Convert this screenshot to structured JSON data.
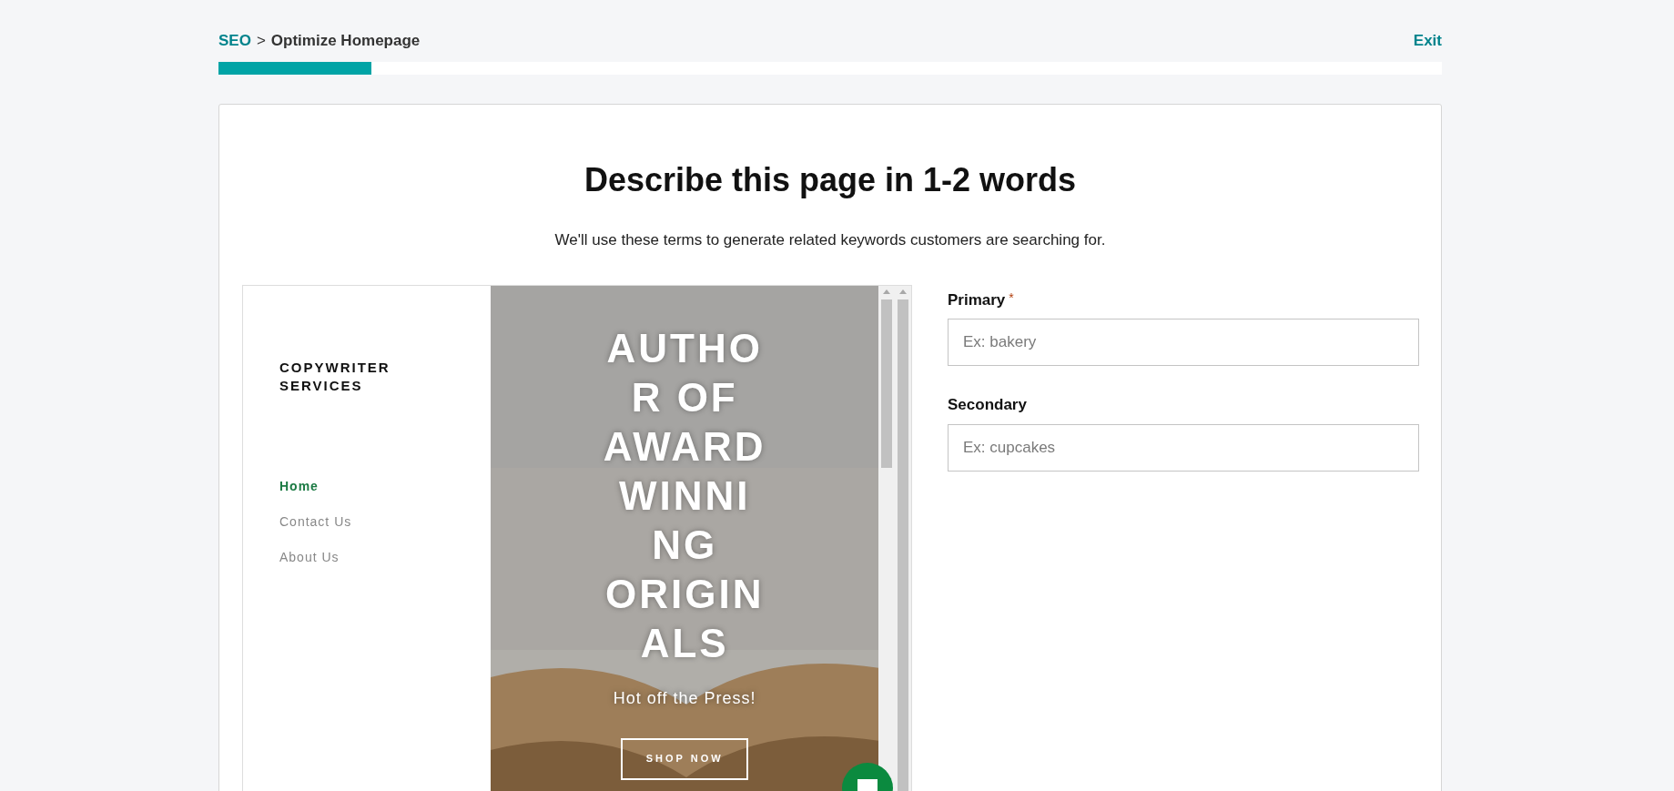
{
  "breadcrumb": {
    "parent": "SEO",
    "separator": ">",
    "current": "Optimize Homepage"
  },
  "exit": "Exit",
  "progress": {
    "level": 0.125
  },
  "heading": "Describe this page in 1-2 words",
  "subheading": "We'll use these terms to generate related keywords customers are searching for.",
  "preview": {
    "site_title": "COPYWRITER SERVICES",
    "nav": [
      {
        "label": "Home",
        "selected": true
      },
      {
        "label": "Contact Us",
        "selected": false
      },
      {
        "label": "About Us",
        "selected": false
      }
    ],
    "hero_lines": [
      "AUTHO",
      "R OF",
      "AWARD",
      "WINNI",
      "NG",
      "ORIGIN",
      "ALS"
    ],
    "tagline": "Hot off the Press!",
    "cta": "SHOP NOW"
  },
  "fields": [
    {
      "label": "Primary",
      "required": true,
      "required_mark": "*",
      "placeholder": "Ex: bakery"
    },
    {
      "label": "Secondary",
      "required": false,
      "placeholder": "Ex: cupcakes"
    }
  ]
}
